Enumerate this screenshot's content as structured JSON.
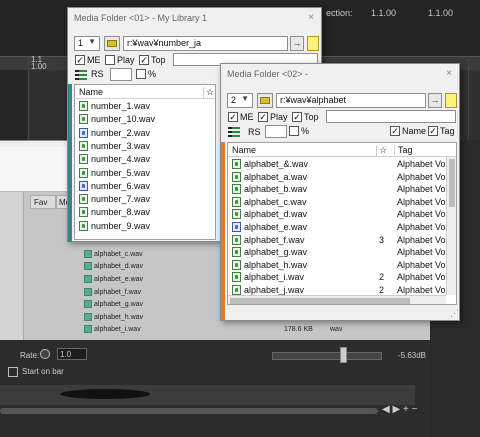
{
  "background": {
    "section_label": "ection:",
    "time_start": "1.1.00",
    "time_end": "1.1.00",
    "ruler_time_1": "1.1",
    "ruler_time_2": "1.00",
    "col_fav": "Fav",
    "col_mo": "Mo",
    "rows": [
      "alphabet_c.wav",
      "alphabet_d.wav",
      "alphabet_e.wav",
      "alphabet_f.wav",
      "alphabet_g.wav",
      "alphabet_h.wav",
      "alphabet_i.wav"
    ],
    "size_text": "178.6 KB",
    "type_text": "wav",
    "rate_label": "Rate:",
    "rate_value": "1.0",
    "db_value": "-5.63dB",
    "start_on_bar": "Start on bar",
    "scroll_buttons": "◀ ▶ + −"
  },
  "window1": {
    "title": "Media Folder <01> - My Library 1",
    "close": "×",
    "number": "1",
    "path": "r:¥wav¥number_ja",
    "go": "→",
    "me_label": "ME",
    "play_label": "Play",
    "top_label": "Top",
    "rs_label": "RS",
    "pct_label": "%",
    "col_name": "Name",
    "col_star": "☆",
    "files": [
      {
        "name": "number_1.wav",
        "blue": false
      },
      {
        "name": "number_10.wav",
        "blue": false
      },
      {
        "name": "number_2.wav",
        "blue": true
      },
      {
        "name": "number_3.wav",
        "blue": false
      },
      {
        "name": "number_4.wav",
        "blue": false
      },
      {
        "name": "number_5.wav",
        "blue": false
      },
      {
        "name": "number_6.wav",
        "blue": true
      },
      {
        "name": "number_7.wav",
        "blue": false
      },
      {
        "name": "number_8.wav",
        "blue": false
      },
      {
        "name": "number_9.wav",
        "blue": false
      }
    ],
    "accent_color": "#2e8a8a"
  },
  "window2": {
    "title": "Media Folder <02> -",
    "close": "×",
    "number": "2",
    "path": "r:¥wav¥alphabet",
    "go": "→",
    "me_label": "ME",
    "play_label": "Play",
    "top_label": "Top",
    "rs_label": "RS",
    "pct_label": "%",
    "name_label": "Name",
    "tag_label": "Tag",
    "col_name": "Name",
    "col_star": "☆",
    "col_tag": "Tag",
    "files": [
      {
        "name": "alphabet_&.wav",
        "star": "",
        "tag": "Alphabet Vo",
        "blue": false
      },
      {
        "name": "alphabet_a.wav",
        "star": "",
        "tag": "Alphabet Vo",
        "blue": false
      },
      {
        "name": "alphabet_b.wav",
        "star": "",
        "tag": "Alphabet Vo",
        "blue": false
      },
      {
        "name": "alphabet_c.wav",
        "star": "",
        "tag": "Alphabet Vo",
        "blue": false
      },
      {
        "name": "alphabet_d.wav",
        "star": "",
        "tag": "Alphabet Vo",
        "blue": false
      },
      {
        "name": "alphabet_e.wav",
        "star": "",
        "tag": "Alphabet Vo",
        "blue": true
      },
      {
        "name": "alphabet_f.wav",
        "star": "3",
        "tag": "Alphabet Vo",
        "blue": false
      },
      {
        "name": "alphabet_g.wav",
        "star": "",
        "tag": "Alphabet Vo",
        "blue": false
      },
      {
        "name": "alphabet_h.wav",
        "star": "",
        "tag": "Alphabet Vo",
        "blue": false
      },
      {
        "name": "alphabet_i.wav",
        "star": "2",
        "tag": "Alphabet Vo",
        "blue": false
      },
      {
        "name": "alphabet_j.wav",
        "star": "2",
        "tag": "Alphabet Vo",
        "blue": false
      }
    ],
    "accent_color": "#e07a30"
  }
}
